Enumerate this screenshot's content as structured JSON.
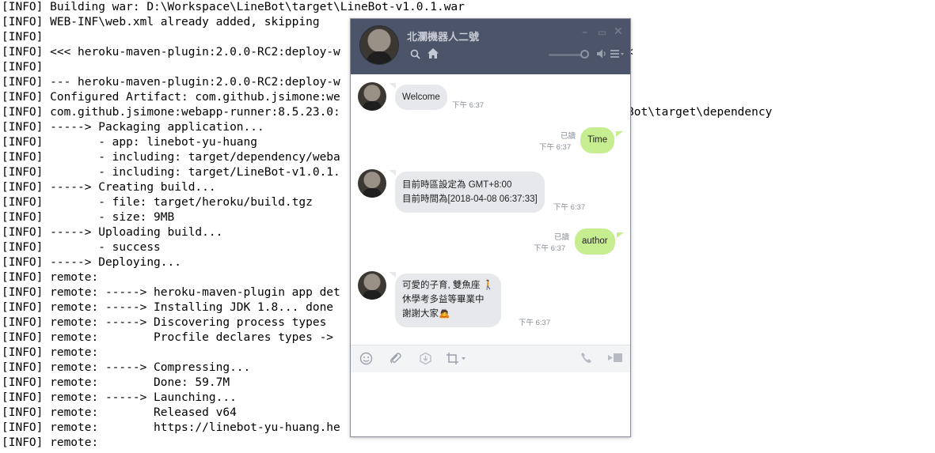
{
  "console": {
    "lines": [
      "[INFO] Building war: D:\\Workspace\\LineBot\\target\\LineBot-v1.0.1.war",
      "[INFO] WEB-INF\\web.xml already added, skipping",
      "[INFO]",
      "[INFO] <<< heroku-maven-plugin:2.0.0-RC2:deploy-w",
      "[INFO]",
      "[INFO] --- heroku-maven-plugin:2.0.0-RC2:deploy-w",
      "[INFO] Configured Artifact: com.github.jsimone:we",
      "[INFO] com.github.jsimone:webapp-runner:8.5.23.0:",
      "[INFO] -----> Packaging application...",
      "[INFO]        - app: linebot-yu-huang",
      "[INFO]        - including: target/dependency/weba",
      "[INFO]        - including: target/LineBot-v1.0.1.",
      "[INFO] -----> Creating build...",
      "[INFO]        - file: target/heroku/build.tgz",
      "[INFO]        - size: 9MB",
      "[INFO] -----> Uploading build...",
      "[INFO]        - success",
      "[INFO] -----> Deploying...",
      "[INFO] remote:",
      "[INFO] remote: -----> heroku-maven-plugin app det",
      "[INFO] remote: -----> Installing JDK 1.8... done",
      "[INFO] remote: -----> Discovering process types",
      "[INFO] remote:        Procfile declares types -> ",
      "[INFO] remote:",
      "[INFO] remote: -----> Compressing...",
      "[INFO] remote:        Done: 59.7M",
      "[INFO] remote: -----> Launching...",
      "[INFO] remote:        Released v64",
      "[INFO] remote:        https://linebot-yu-huang.he",
      "[INFO] remote:"
    ],
    "overflow_line": "Bot\\target\\dependency",
    "overflow_fragment": "<"
  },
  "chat": {
    "title": "北瀾機器人二號",
    "window_controls": {
      "minimize": "–",
      "maximize": "▭",
      "close": "✕"
    },
    "icons": {
      "search": "search-icon",
      "home": "home-icon",
      "volume": "volume-icon",
      "menu": "menu-icon"
    },
    "messages": [
      {
        "side": "in",
        "text": "Welcome",
        "time": "下午 6:37"
      },
      {
        "side": "out",
        "text": "Time",
        "read": "已讀",
        "time": "下午 6:37"
      },
      {
        "side": "in",
        "text": "目前時區設定為 GMT+8:00\n目前時間為[2018-04-08 06:37:33]",
        "time": "下午 6:37"
      },
      {
        "side": "out",
        "text": "author",
        "read": "已讀",
        "time": "下午 6:37"
      },
      {
        "side": "in",
        "text": "可愛的子育, 雙魚座 🚶\n休學考多益等畢業中\n謝謝大家🙇",
        "time": "下午 6:37"
      }
    ],
    "toolbar_icons": [
      "emoji-icon",
      "attach-icon",
      "keep-icon",
      "capture-icon",
      "call-icon",
      "video-icon"
    ],
    "colors": {
      "header": "#4b5468",
      "outgoing_bubble": "#c6ee91",
      "incoming_bubble": "#e6e8ec"
    }
  }
}
